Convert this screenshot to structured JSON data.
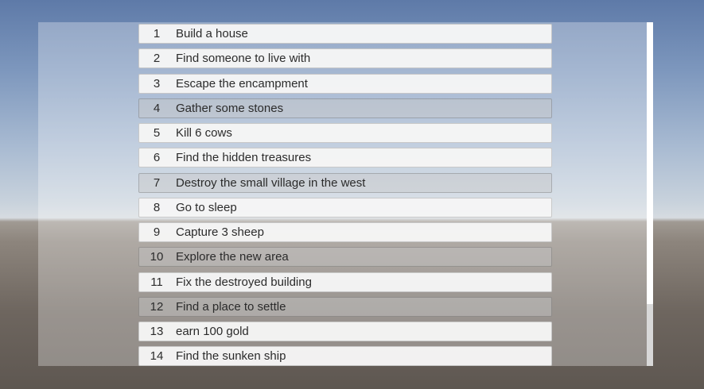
{
  "quests": [
    {
      "number": "1",
      "text": "Build a house",
      "state": "normal"
    },
    {
      "number": "2",
      "text": "Find someone to live with",
      "state": "normal"
    },
    {
      "number": "3",
      "text": "Escape the encampment",
      "state": "normal"
    },
    {
      "number": "4",
      "text": "Gather some stones",
      "state": "dim"
    },
    {
      "number": "5",
      "text": "Kill 6 cows",
      "state": "normal"
    },
    {
      "number": "6",
      "text": "Find the hidden treasures",
      "state": "normal"
    },
    {
      "number": "7",
      "text": "Destroy the small village in the west",
      "state": "dim"
    },
    {
      "number": "8",
      "text": "Go to sleep",
      "state": "normal"
    },
    {
      "number": "9",
      "text": "Capture 3 sheep",
      "state": "normal"
    },
    {
      "number": "10",
      "text": "Explore the new area",
      "state": "dim"
    },
    {
      "number": "11",
      "text": "Fix the destroyed building",
      "state": "normal"
    },
    {
      "number": "12",
      "text": "Find a place to settle",
      "state": "dim"
    },
    {
      "number": "13",
      "text": "earn 100 gold",
      "state": "normal"
    },
    {
      "number": "14",
      "text": "Find the sunken ship",
      "state": "normal"
    }
  ],
  "colors": {
    "row_normal": "#f5f5f5",
    "row_dim": "#c8c8c8",
    "text": "#2b2b2b"
  }
}
